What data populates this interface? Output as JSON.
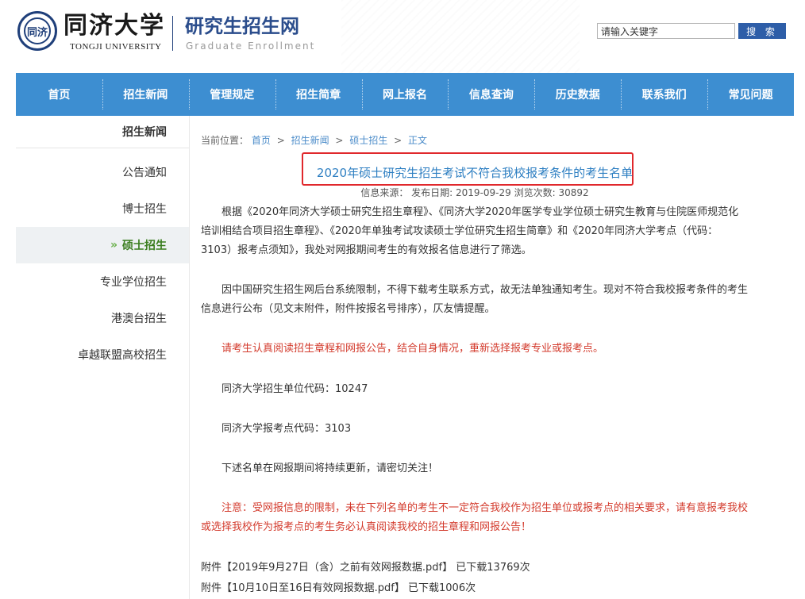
{
  "header": {
    "logo_seal_text": "同济",
    "university_cn": "同济大学",
    "university_en": "TONGJI UNIVERSITY",
    "site_title_cn": "研究生招生网",
    "site_title_en": "Graduate Enrollment",
    "search_value": "请输入关键字",
    "search_button": "搜 索"
  },
  "nav": {
    "items": [
      "首页",
      "招生新闻",
      "管理规定",
      "招生简章",
      "网上报名",
      "信息查询",
      "历史数据",
      "联系我们",
      "常见问题"
    ]
  },
  "sidebar": {
    "title": "招生新闻",
    "items": [
      {
        "label": "公告通知",
        "active": false
      },
      {
        "label": "博士招生",
        "active": false
      },
      {
        "label": "硕士招生",
        "active": true
      },
      {
        "label": "专业学位招生",
        "active": false
      },
      {
        "label": "港澳台招生",
        "active": false
      },
      {
        "label": "卓越联盟高校招生",
        "active": false
      }
    ],
    "active_marker": "»"
  },
  "breadcrumb": {
    "prefix": "当前位置：",
    "items": [
      "首页",
      "招生新闻",
      "硕士招生",
      "正文"
    ],
    "separator": ">"
  },
  "article": {
    "title": "2020年硕士研究生招生考试不符合我校报考条件的考生名单",
    "meta": "信息来源：  发布日期: 2019-09-29  浏览次数: 30892",
    "paragraphs": [
      "根据《2020年同济大学硕士研究生招生章程》、《同济大学2020年医学专业学位硕士研究生教育与住院医师规范化培训相结合项目招生章程》、《2020年单独考试攻读硕士学位研究生招生简章》和《2020年同济大学考点（代码：3103）报考点须知》，我处对网报期间考生的有效报名信息进行了筛选。",
      "因中国研究生招生网后台系统限制，不得下载考生联系方式，故无法单独通知考生。现对不符合我校报考条件的考生信息进行公布（见文末附件，附件按报名号排序），仄友情提醒。",
      "请考生认真阅读招生章程和网报公告，结合自身情况，重新选择报考专业或报考点。",
      "同济大学招生单位代码：10247",
      "同济大学报考点代码：3103",
      "下述名单在网报期间将持续更新，请密切关注！",
      "注意：受网报信息的限制，未在下列名单的考生不一定符合我校作为招生单位或报考点的相关要求，请有意报考我校或选择我校作为报考点的考生务必认真阅读我校的招生章程和网报公告！"
    ],
    "attachments": [
      {
        "prefix": "附件",
        "name": "【2019年9月27日（含）之前有效网报数据.pdf】",
        "downloads": "已下载13769次"
      },
      {
        "prefix": "附件",
        "name": "【10月10日至16日有效网报数据.pdf】",
        "downloads": "已下载1006次"
      }
    ]
  },
  "colors": {
    "nav_bg": "#3d8ed1",
    "title_blue": "#2e7fc2",
    "notice_red": "#d33a2c",
    "highlight_box": "#e0282c",
    "active_green": "#3a7d1e"
  }
}
